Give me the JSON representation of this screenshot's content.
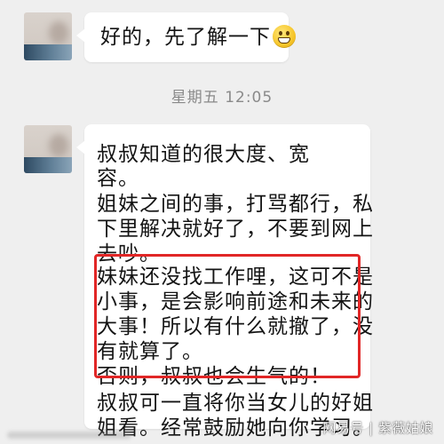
{
  "messages": [
    {
      "text": "好的，先了解一下",
      "emoji": "grinning-face"
    },
    {
      "lines": [
        "               叔叔知道的很大度、宽",
        "容。",
        "姐妹之间的事，打骂都行，私",
        "下里解决就好了，不要到网上",
        "去吵。",
        "妹妹还没找工作哩，这可不是",
        "小事，是会影响前途和未来的",
        "大事！所以有什么就撤了，没",
        "有就算了。",
        "否则，叔叔也会生气的！",
        "叔叔可一直将你当女儿的好姐",
        "姐看。经常鼓励她向你学习。"
      ]
    }
  ],
  "timestamp": "星期五 12:05",
  "watermark": "网易号 | 紫薇姑娘",
  "colors": {
    "background": "#efefef",
    "bubble": "#ffffff",
    "highlight": "#e12626"
  }
}
